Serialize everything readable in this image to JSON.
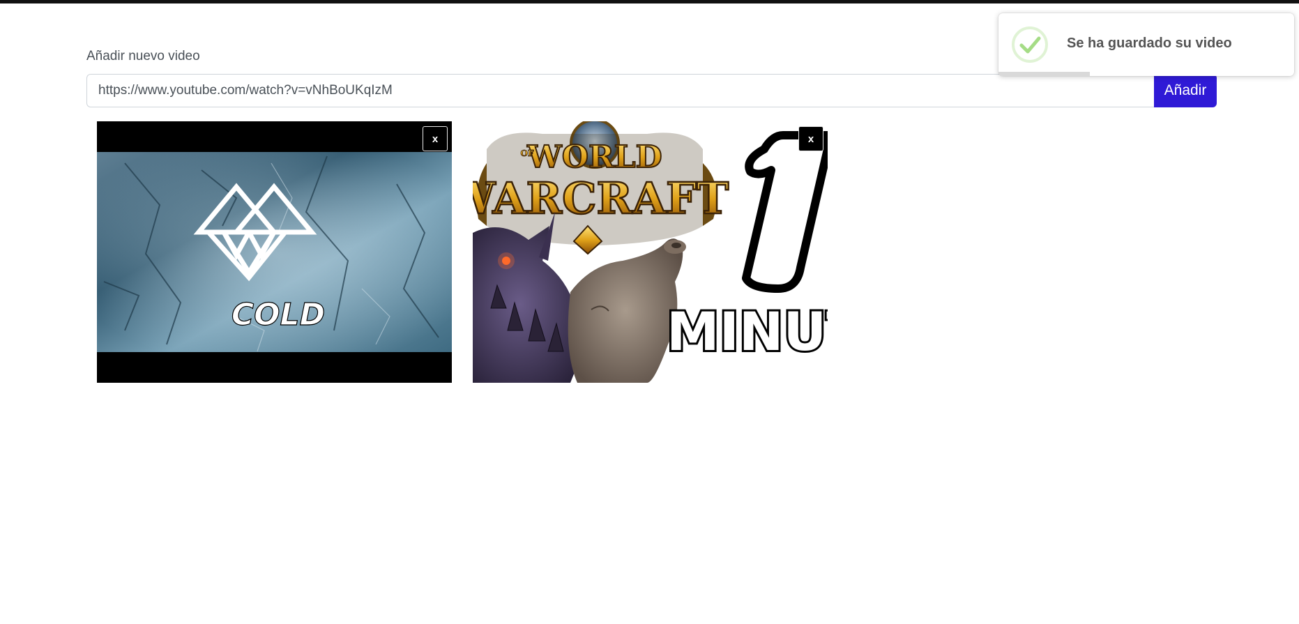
{
  "form": {
    "label": "Añadir nuevo video",
    "url_value": "https://www.youtube.com/watch?v=vNhBoUKqIzM",
    "add_label": "Añadir"
  },
  "videos": [
    {
      "thumbnail_text": "COLD",
      "close_label": "x"
    },
    {
      "thumbnail_text_top": "WORLD",
      "thumbnail_text_of": "OF",
      "thumbnail_text_main": "WARCRAFT",
      "thumbnail_text_number": "1",
      "thumbnail_text_bottom": "MINUTO",
      "close_label": "x"
    }
  ],
  "toast": {
    "message": "Se ha guardado su video",
    "icon": "success-check-icon",
    "progress_remaining": 0.31
  },
  "colors": {
    "accent": "#2f1ad6",
    "success": "#a5dc86"
  }
}
